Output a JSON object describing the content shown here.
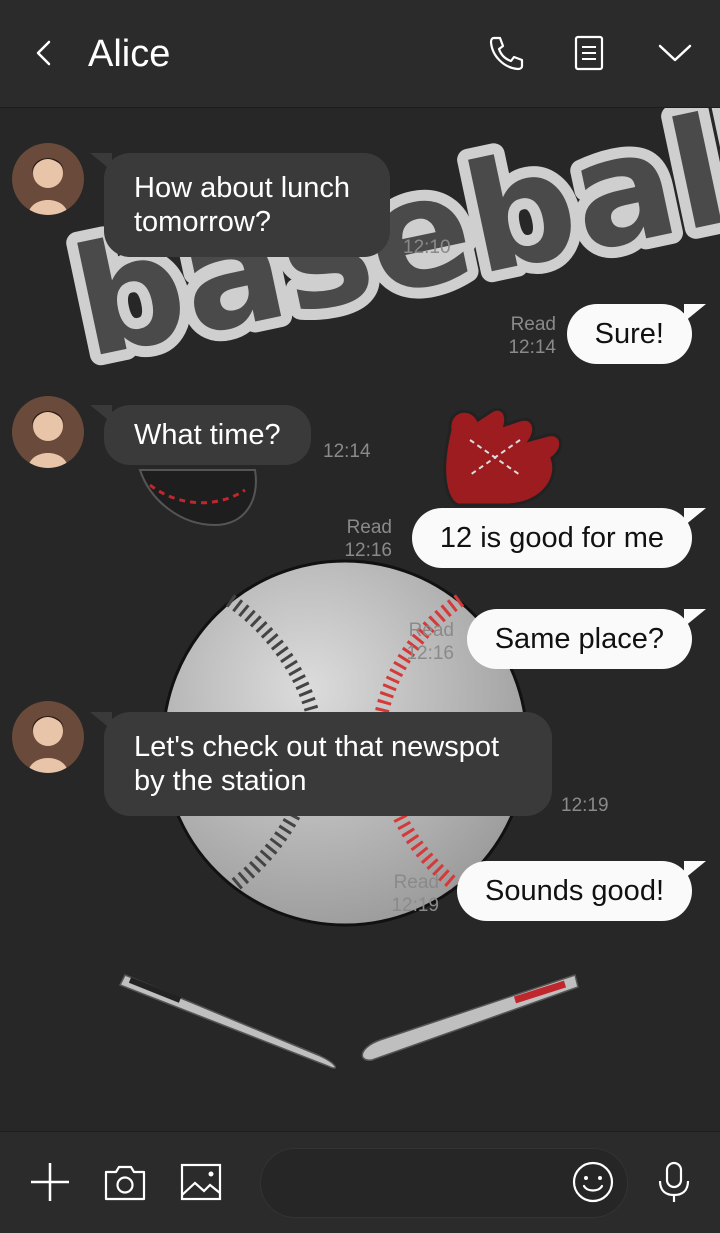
{
  "header": {
    "title": "Alice",
    "back_icon": "chevron-left-icon",
    "call_icon": "phone-icon",
    "memo_icon": "note-icon",
    "menu_icon": "chevron-down-icon"
  },
  "messages": [
    {
      "side": "in",
      "text": "How about lunch tomorrow?",
      "time": "12:10"
    },
    {
      "side": "out",
      "text": "Sure!",
      "read": "Read",
      "time": "12:14"
    },
    {
      "side": "in",
      "text": "What time?",
      "time": "12:14"
    },
    {
      "side": "out",
      "text": "12 is good for me",
      "read": "Read",
      "time": "12:16"
    },
    {
      "side": "out",
      "text": "Same place?",
      "read": "Read",
      "time": "12:16"
    },
    {
      "side": "in",
      "text": "Let's check out that newspot by the station",
      "time": "12:19"
    },
    {
      "side": "out",
      "text": "Sounds good!",
      "read": "Read",
      "time": "12:19"
    }
  ],
  "background": {
    "word": "baseball"
  },
  "footer": {
    "plus_icon": "plus-icon",
    "camera_icon": "camera-icon",
    "image_icon": "image-icon",
    "input_value": "",
    "emoji_icon": "smiley-icon",
    "mic_icon": "microphone-icon"
  },
  "colors": {
    "background": "#272727",
    "incoming_bubble": "#3a3a3a",
    "outgoing_bubble": "#fafafa",
    "meta_text": "#8a8a8a"
  }
}
